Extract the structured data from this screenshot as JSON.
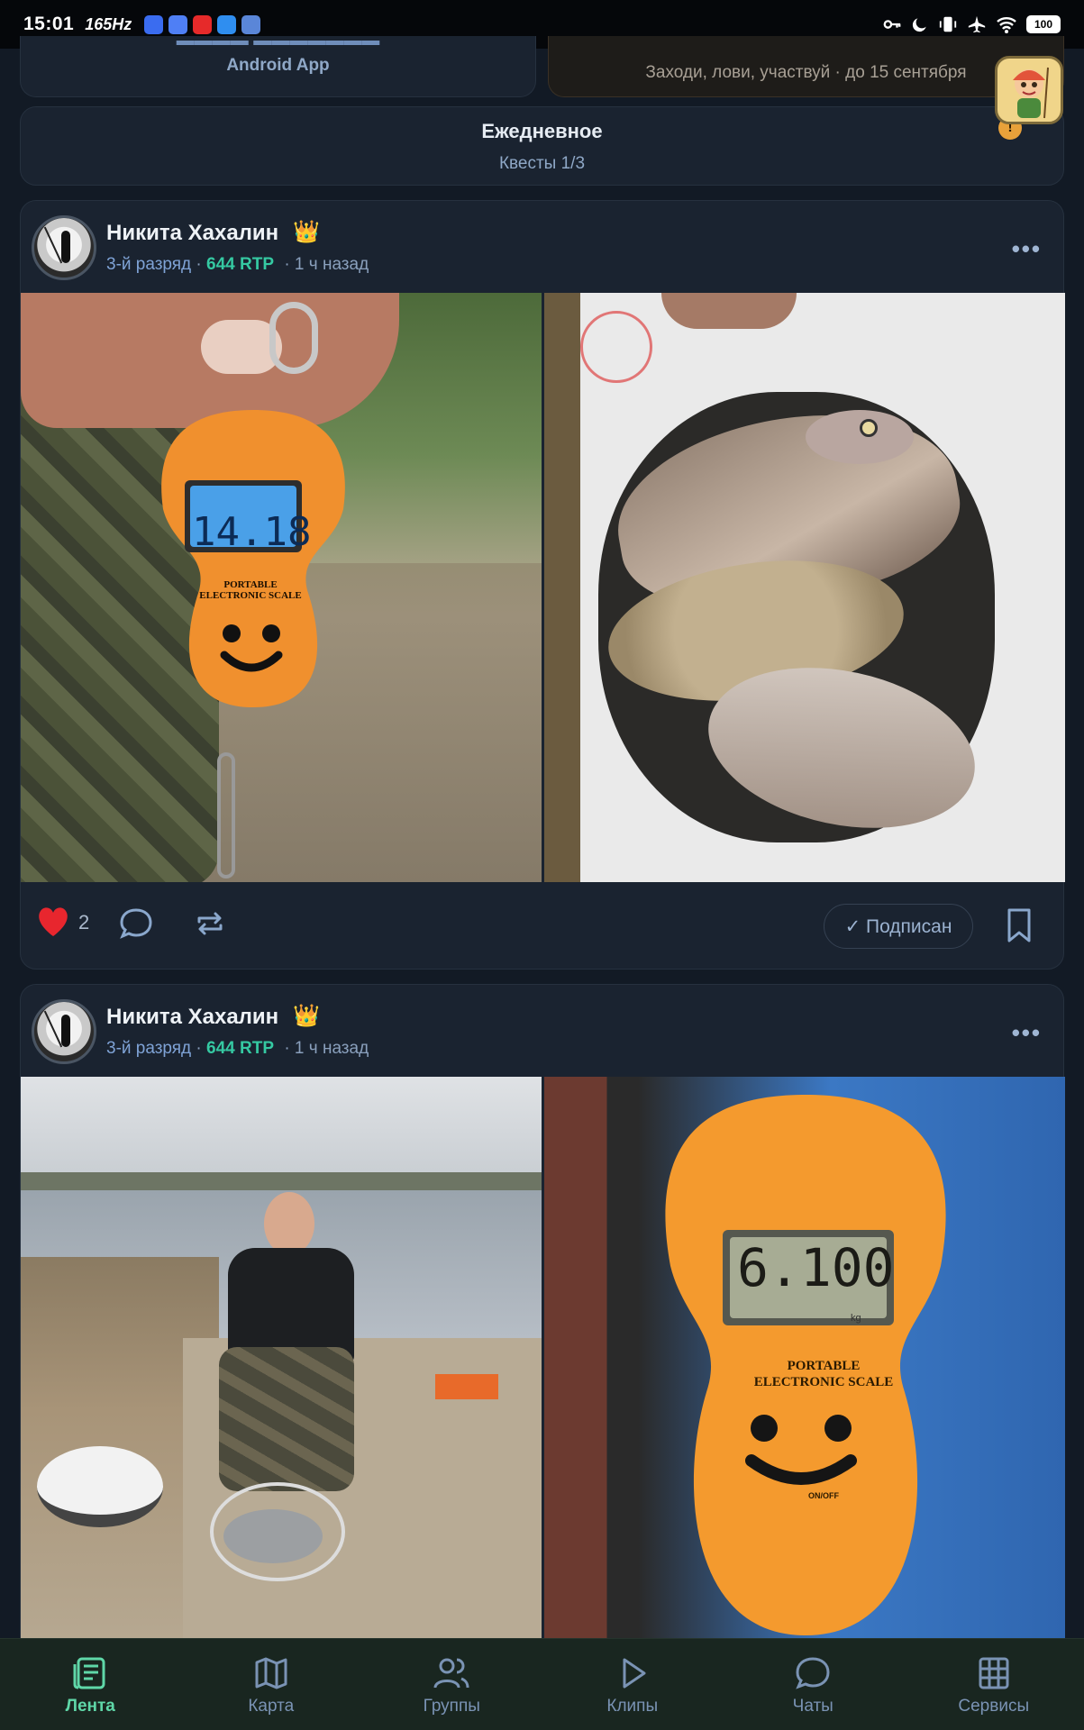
{
  "status_bar": {
    "time": "15:01",
    "refresh_rate": "165Hz",
    "battery": "100"
  },
  "top_cards": {
    "left_sub": "Android App",
    "right_sub": "Заходи, лови, участвуй · до 15 сентября"
  },
  "daily": {
    "title": "Ежедневное",
    "subtitle": "Квесты 1/3"
  },
  "posts": [
    {
      "author": "Никита Хахалин",
      "rank": "3-й разряд",
      "rtp": "644 RTP",
      "time": "1 ч назад",
      "likes": "2",
      "subscribe_label": "✓ Подписан",
      "scale_reading": "14.18"
    },
    {
      "author": "Никита Хахалин",
      "rank": "3-й разряд",
      "rtp": "644 RTP",
      "time": "1 ч назад",
      "scale_reading": "6.100"
    }
  ],
  "scale": {
    "line1": "PORTABLE",
    "line2": "ELECTRONIC SCALE",
    "unit": "kg",
    "onoff": "ON/OFF"
  },
  "nav": [
    {
      "label": "Лента",
      "icon": "feed-icon"
    },
    {
      "label": "Карта",
      "icon": "map-icon"
    },
    {
      "label": "Группы",
      "icon": "groups-icon"
    },
    {
      "label": "Клипы",
      "icon": "play-icon"
    },
    {
      "label": "Чаты",
      "icon": "chat-icon"
    },
    {
      "label": "Сервисы",
      "icon": "grid-icon"
    }
  ],
  "colors": {
    "accent": "#5fd7a8",
    "rtp": "#35c9a2",
    "background": "#121a25",
    "card": "#1a2330"
  }
}
